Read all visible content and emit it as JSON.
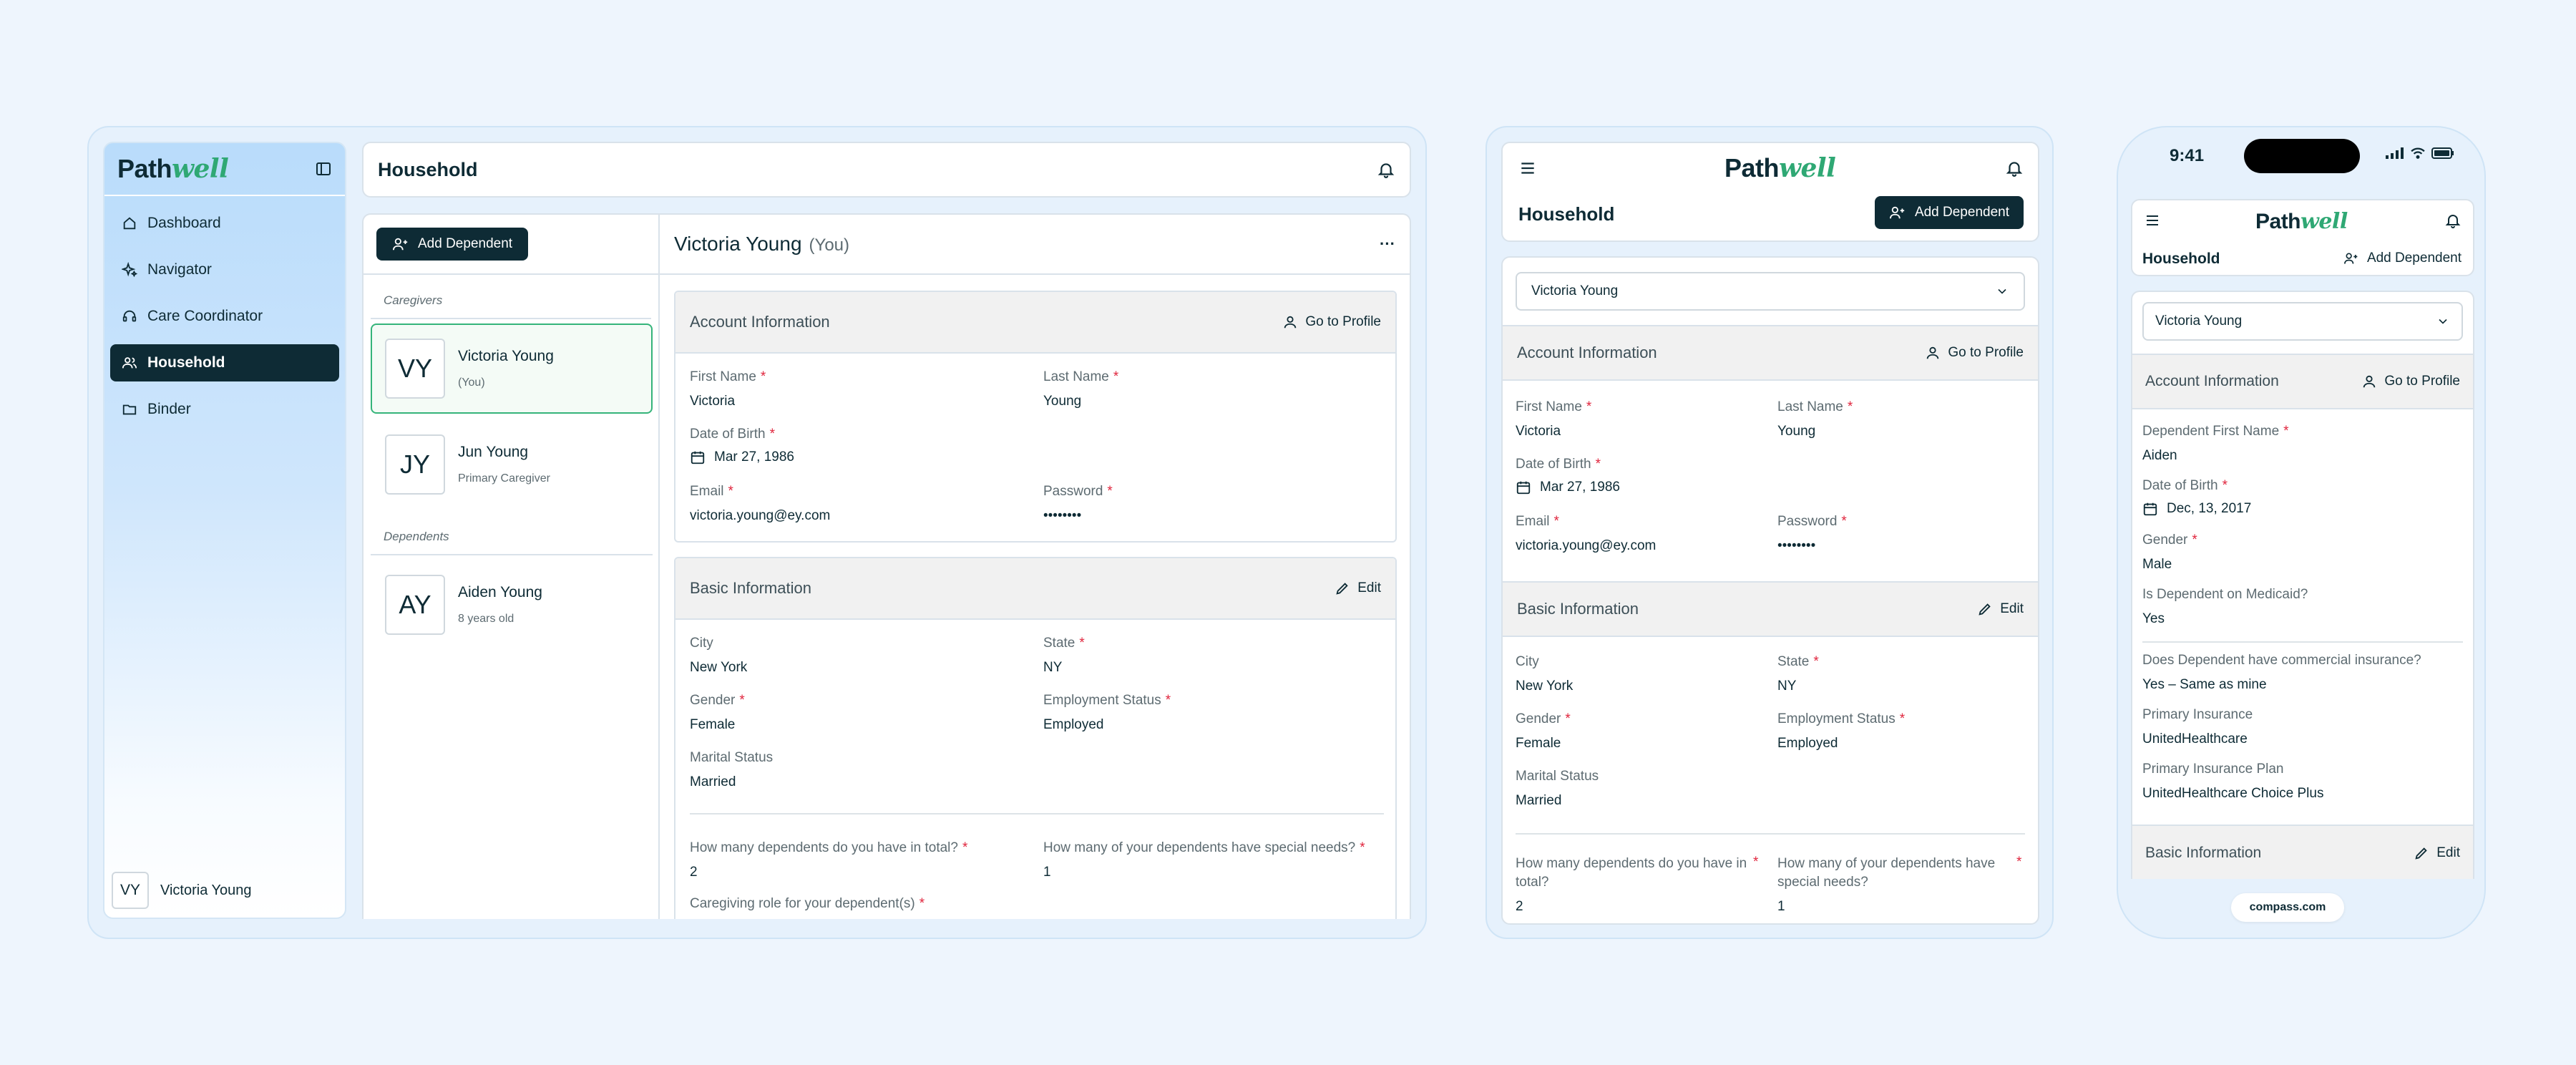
{
  "app": {
    "brand_a": "Path",
    "brand_b": "well"
  },
  "sidebar": {
    "items": [
      {
        "label": "Dashboard",
        "icon": "home-icon"
      },
      {
        "label": "Navigator",
        "icon": "sparkle-icon"
      },
      {
        "label": "Care Coordinator",
        "icon": "headset-icon"
      },
      {
        "label": "Household",
        "icon": "users-icon",
        "active": true
      },
      {
        "label": "Binder",
        "icon": "folder-icon"
      }
    ],
    "user": {
      "initials": "VY",
      "name": "Victoria Young"
    }
  },
  "header": {
    "title": "Household"
  },
  "actions": {
    "add_dependent": "Add Dependent",
    "go_to_profile": "Go to Profile",
    "edit": "Edit"
  },
  "household": {
    "caregivers_heading": "Caregivers",
    "dependents_heading": "Dependents",
    "caregivers": [
      {
        "initials": "VY",
        "name": "Victoria Young",
        "sub": "(You)"
      },
      {
        "initials": "JY",
        "name": "Jun Young",
        "sub": "Primary Caregiver"
      }
    ],
    "dependents": [
      {
        "initials": "AY",
        "name": "Aiden Young",
        "sub": "8 years old"
      }
    ]
  },
  "detail": {
    "name": "Victoria Young",
    "suffix": "(You)",
    "more": "···"
  },
  "account": {
    "title": "Account Information",
    "first_name_label": "First Name",
    "first_name": "Victoria",
    "last_name_label": "Last Name",
    "last_name": "Young",
    "dob_label": "Date of Birth",
    "dob": "Mar 27, 1986",
    "email_label": "Email",
    "email": "victoria.young@ey.com",
    "password_label": "Password",
    "password": "••••••••"
  },
  "basic": {
    "title": "Basic Information",
    "city_label": "City",
    "city": "New York",
    "state_label": "State",
    "state": "NY",
    "gender_label": "Gender",
    "gender": "Female",
    "employment_label": "Employment Status",
    "employment": "Employed",
    "marital_label": "Marital Status",
    "marital": "Married",
    "dependents_total_label": "How many dependents do you have in total?",
    "dependents_total": "2",
    "special_needs_label": "How many of your dependents have special needs?",
    "special_needs": "1",
    "caregiving_role_label": "Caregiving role for your dependent(s)"
  },
  "tablet": {
    "selected": "Victoria Young"
  },
  "phone": {
    "time": "9:41",
    "selected": "Victoria Young",
    "dep_first_name_label": "Dependent First Name",
    "dep_first_name": "Aiden",
    "dob_label": "Date of Birth",
    "dob": "Dec, 13, 2017",
    "gender_label": "Gender",
    "gender": "Male",
    "medicaid_label": "Is Dependent on Medicaid?",
    "medicaid": "Yes",
    "commercial_label": "Does Dependent have commercial insurance?",
    "commercial": "Yes – Same as mine",
    "primary_ins_label": "Primary Insurance",
    "primary_ins": "UnitedHealthcare",
    "primary_plan_label": "Primary Insurance Plan",
    "primary_plan": "UnitedHealthcare Choice Plus",
    "url": "compass.com"
  },
  "colors": {
    "brand_dark": "#0e2b35",
    "brand_green": "#2fa874",
    "required": "#e0243c",
    "sidebar_top": "#b9dcfb"
  }
}
